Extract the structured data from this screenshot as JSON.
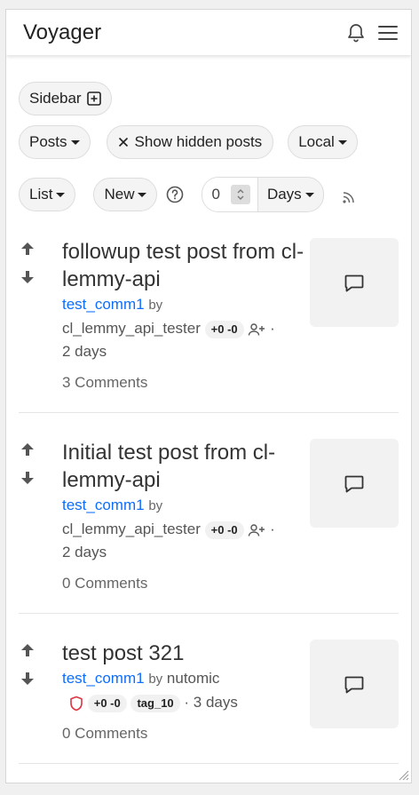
{
  "app": {
    "title": "Voyager"
  },
  "controls": {
    "sidebar_label": "Sidebar",
    "posts_label": "Posts",
    "show_hidden_label": "Show hidden posts",
    "local_label": "Local",
    "list_label": "List",
    "new_label": "New",
    "days_value": "0",
    "days_label": "Days"
  },
  "posts": [
    {
      "title": "followup test post from cl-lemmy-api",
      "community": "test_comm1",
      "by": "by",
      "author": "cl_lemmy_api_tester",
      "score": "+0 -0",
      "age": "2 days",
      "comments": "3 Comments"
    },
    {
      "title": "Initial test post from cl-lemmy-api",
      "community": "test_comm1",
      "by": "by",
      "author": "cl_lemmy_api_tester",
      "score": "+0 -0",
      "age": "2 days",
      "comments": "0 Comments"
    },
    {
      "title": "test post 321",
      "community": "test_comm1",
      "by": "by",
      "author": "nutomic",
      "score": "+0 -0",
      "tag": "tag_10",
      "age": "· 3 days",
      "comments": "0 Comments"
    }
  ],
  "colors": {
    "link": "#0d6efd",
    "mod_shield": "#dc3545"
  }
}
